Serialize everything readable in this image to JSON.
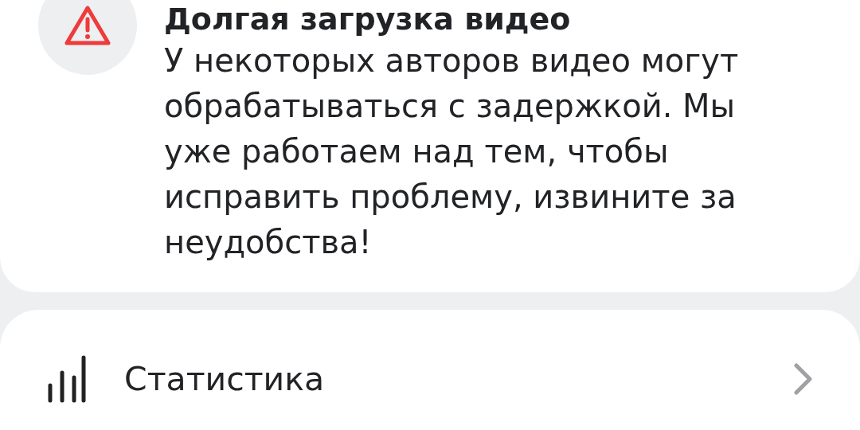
{
  "notice": {
    "title": "Долгая загрузка видео",
    "text": "У некоторых авторов видео могут обрабатываться с задержкой. Мы уже работаем над тем, чтобы исправить проблему, извините за неудобства!"
  },
  "menu": [
    {
      "label": "Статистика"
    }
  ]
}
